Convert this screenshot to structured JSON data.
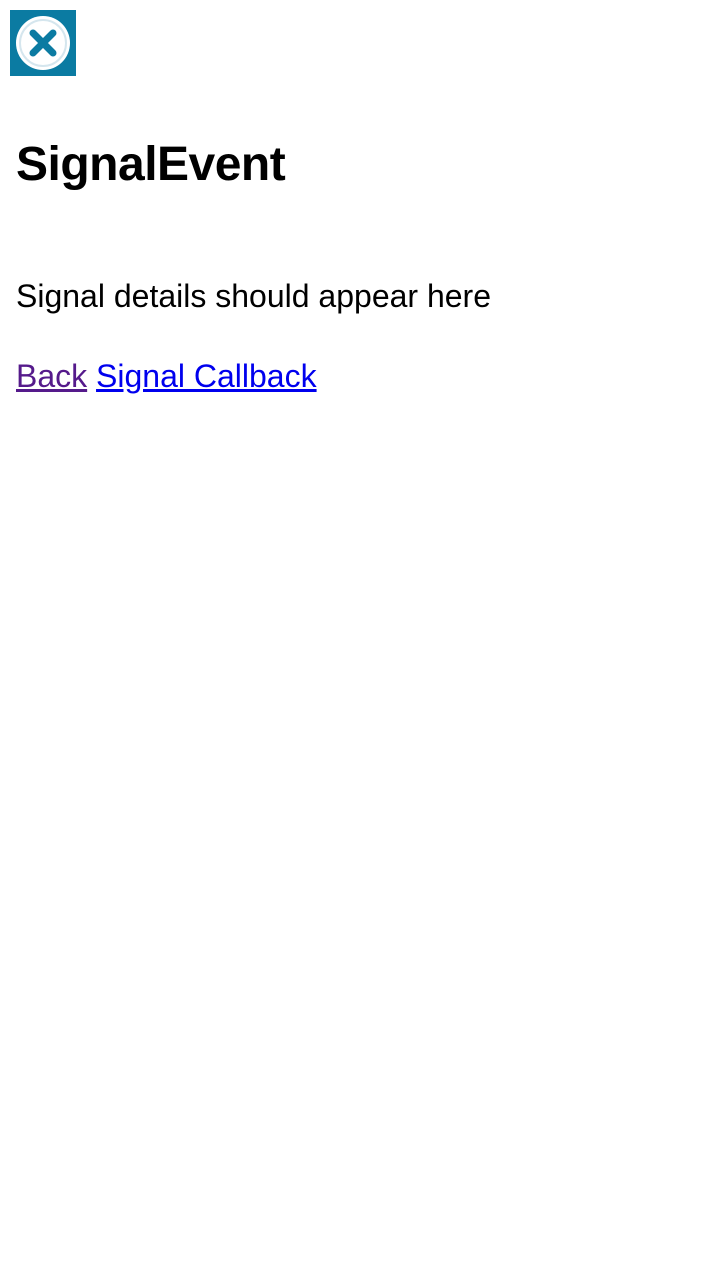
{
  "close": {
    "icon": "close-circle-icon",
    "accent_color": "#0b7ba2"
  },
  "page": {
    "title": "SignalEvent",
    "details": "Signal details should appear here"
  },
  "links": {
    "back_label": "Back",
    "back_color": "#551a8b",
    "callback_label": "Signal Callback",
    "callback_color": "#0000ee"
  }
}
